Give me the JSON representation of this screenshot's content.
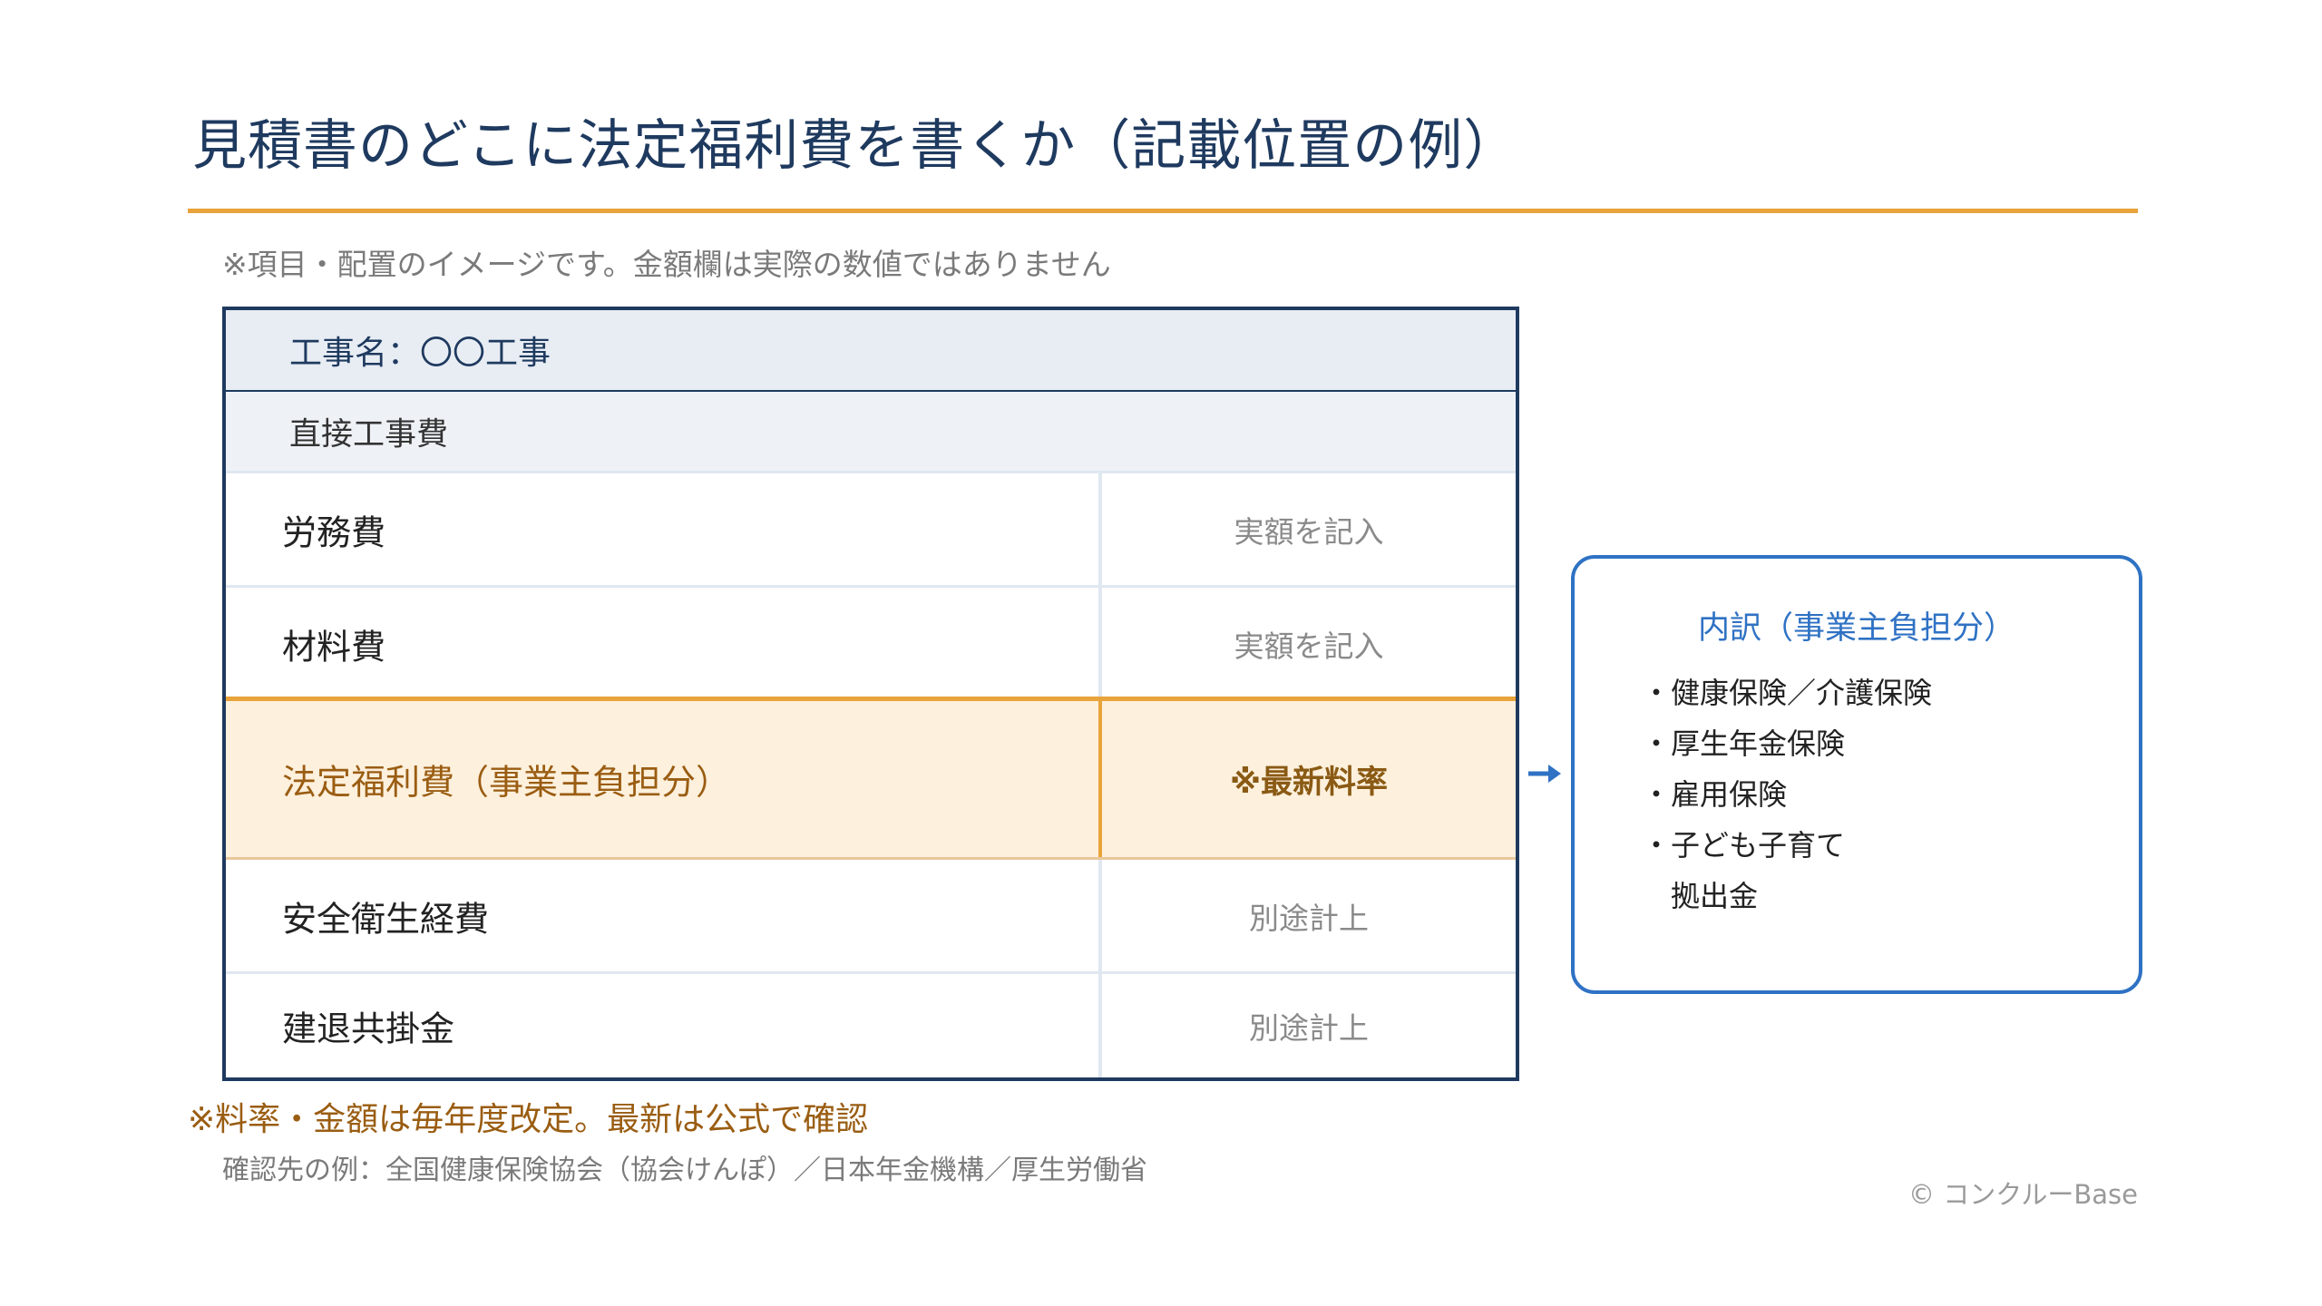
{
  "title": "見積書のどこに法定福利費を書くか（記載位置の例）",
  "subnote": "※項目・配置のイメージです。金額欄は実際の数値ではありません",
  "estimate": {
    "project_label": "工事名：〇〇工事",
    "direct_cost_label": "直接工事費",
    "rows": [
      {
        "label": "労務費",
        "value": "実額を記入"
      },
      {
        "label": "材料費",
        "value": "実額を記入"
      },
      {
        "label": "法定福利費（事業主負担分）",
        "value": "※最新料率"
      },
      {
        "label": "安全衛生経費",
        "value": "別途計上"
      },
      {
        "label": "建退共掛金",
        "value": "別途計上"
      }
    ]
  },
  "breakdown": {
    "title": "内訳（事業主負担分）",
    "items": [
      "・健康保険／介護保険",
      "・厚生年金保険",
      "・雇用保険",
      "・子ども子育て",
      "　拠出金"
    ]
  },
  "footnote": {
    "main": "※料率・金額は毎年度改定。最新は公式で確認",
    "sub": "確認先の例：全国健康保険協会（協会けんぽ）／日本年金機構／厚生労働省"
  },
  "copyright": "© コンクルーBase",
  "colors": {
    "navy": "#1f3a5f",
    "accent_orange": "#e8a33a",
    "highlight_fill": "#fdf0dc",
    "breakdown_blue": "#2f72c4"
  }
}
